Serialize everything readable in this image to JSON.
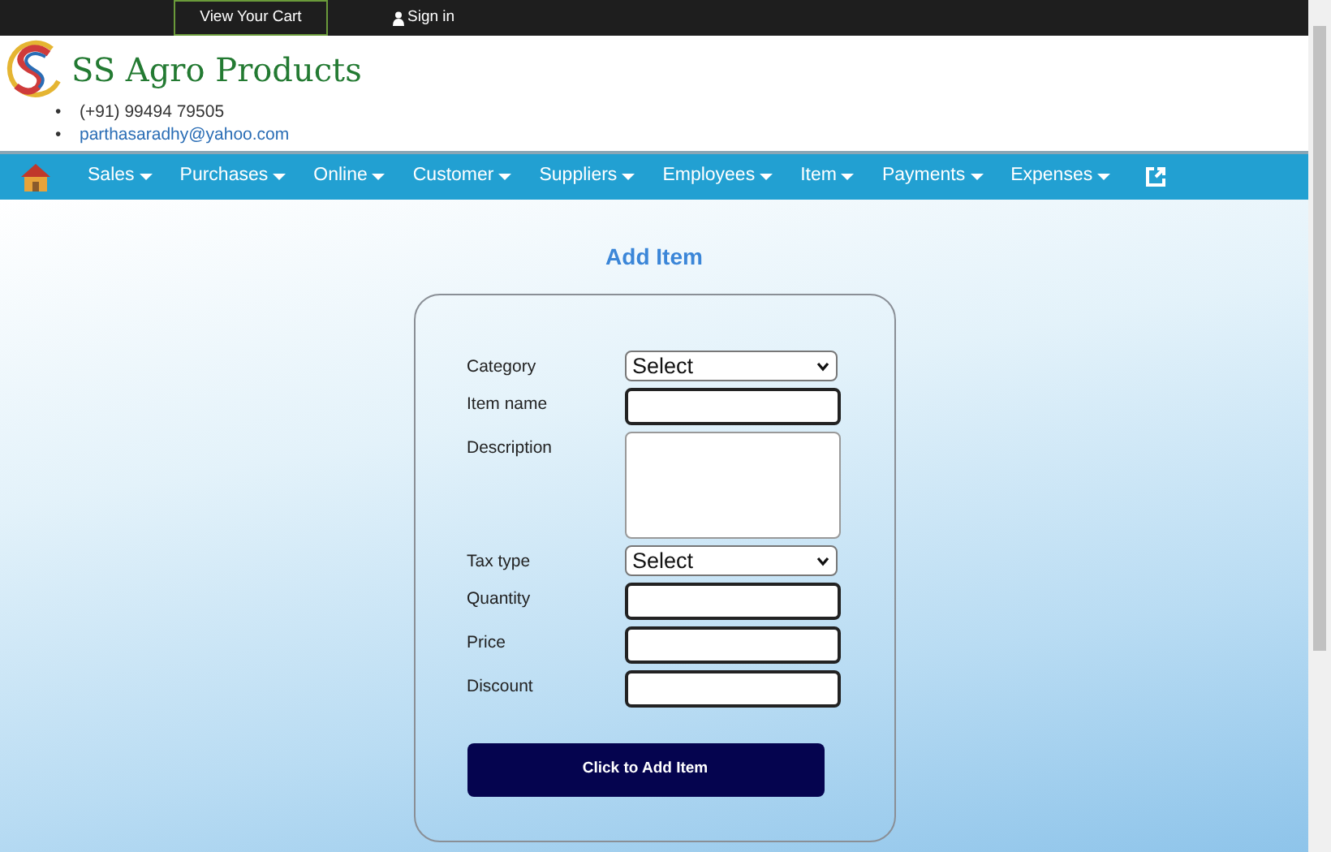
{
  "top_bar": {
    "cart_button": "View Your Cart",
    "sign_in": "Sign in"
  },
  "header": {
    "brand": "SS Agro Products",
    "contacts": [
      {
        "kind": "text",
        "bullet": "•",
        "text": "(+91) 99494 79505"
      },
      {
        "kind": "link",
        "bullet": "•",
        "text": "parthasaradhy@yahoo.com"
      }
    ]
  },
  "nav": {
    "items": [
      "Sales",
      "Purchases",
      "Online",
      "Customer",
      "Suppliers",
      "Employees",
      "Item",
      "Payments",
      "Expenses"
    ]
  },
  "form": {
    "title": "Add Item",
    "fields": [
      {
        "label": "Category",
        "kind": "select",
        "value": "Select"
      },
      {
        "label": "Item name",
        "kind": "input",
        "highlighted": true
      },
      {
        "label": "Description",
        "kind": "textarea"
      },
      {
        "label": "Tax type",
        "kind": "select",
        "value": "Select"
      },
      {
        "label": "Quantity",
        "kind": "input",
        "highlighted": true
      },
      {
        "label": "Price",
        "kind": "input",
        "highlighted": true
      },
      {
        "label": "Discount",
        "kind": "input",
        "highlighted": true
      }
    ],
    "submit": "Click to Add Item"
  }
}
